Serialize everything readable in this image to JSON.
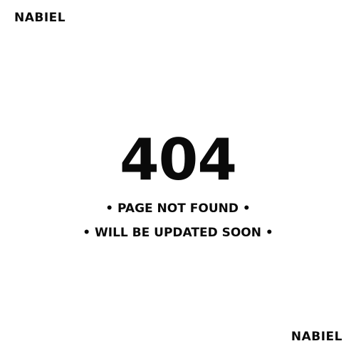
{
  "brand": {
    "top_label": "NABIEL",
    "bottom_label": "NABIEL"
  },
  "error": {
    "code": "404",
    "line1": "• PAGE NOT FOUND •",
    "line2": "• WILL BE UPDATED SOON •"
  },
  "colors": {
    "background": "#ffffff",
    "text": "#0a0a0a"
  }
}
